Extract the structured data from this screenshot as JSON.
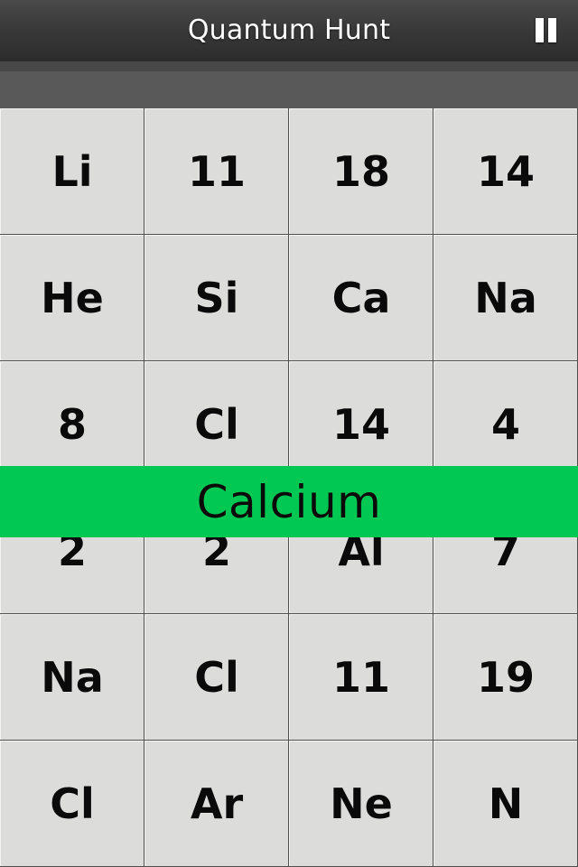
{
  "header": {
    "title": "Quantum Hunt",
    "pause_icon": "pause-icon"
  },
  "target": {
    "label": "Calcium",
    "color": "#00c853"
  },
  "grid": {
    "columns": 4,
    "rows": 6,
    "cells": [
      [
        "Li",
        "11",
        "18",
        "14"
      ],
      [
        "He",
        "Si",
        "Ca",
        "Na"
      ],
      [
        "8",
        "Cl",
        "14",
        "4"
      ],
      [
        "2",
        "2",
        "Al",
        "7"
      ],
      [
        "Na",
        "Cl",
        "11",
        "19"
      ],
      [
        "Cl",
        "Ar",
        "Ne",
        "N"
      ]
    ]
  }
}
